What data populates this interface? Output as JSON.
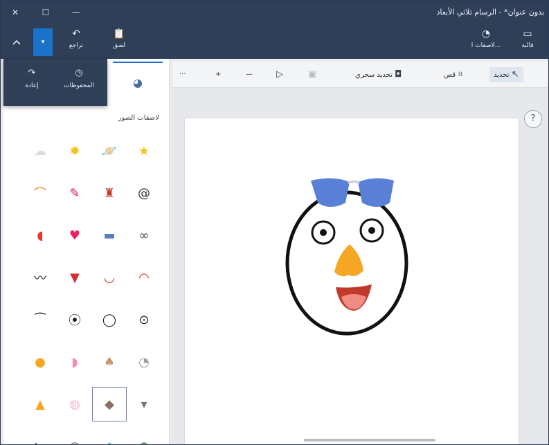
{
  "window": {
    "title": "بدون عنوان* - الرسام ثلاثي الأبعاد",
    "close_glyph": "✕",
    "restore_glyph": "☐",
    "minimize_glyph": "—"
  },
  "ribbon": {
    "canvas_label": "قالبة",
    "stickers_label": "لاصقات ا...",
    "paste_label": "لصق",
    "undo_label": "تراجع",
    "collapse_icon": "chevron-up-icon",
    "dropdown_glyph": "▾"
  },
  "history_menu": {
    "history_label": "المحفوظات",
    "redo_label": "إعادة"
  },
  "toolbar": {
    "select_label": "تحديد",
    "crop_label": "قص",
    "magic_select_label": "تحديد سحري",
    "more_glyph": "···",
    "zoom_in_glyph": "+",
    "zoom_out_glyph": "—"
  },
  "panel": {
    "section_title": "لاصقات الصور",
    "tab_icon": "sticker-icon",
    "stickers": [
      {
        "name": "star-sticker",
        "glyph": "★",
        "color": "#f5c518"
      },
      {
        "name": "planet-sticker",
        "glyph": "🪐",
        "color": "#4caf50"
      },
      {
        "name": "sun-sticker",
        "glyph": "✹",
        "color": "#f7c21a"
      },
      {
        "name": "cloud-sticker",
        "glyph": "☁",
        "color": "#d8dde3"
      },
      {
        "name": "spiral-sticker",
        "glyph": "@",
        "color": "#333333"
      },
      {
        "name": "robot-sticker",
        "glyph": "♜",
        "color": "#c0392b"
      },
      {
        "name": "lollipop-sticker",
        "glyph": "✎",
        "color": "#d81b60"
      },
      {
        "name": "rainbow-sticker",
        "glyph": "⌒",
        "color": "#e67e22"
      },
      {
        "name": "eyes-sticker",
        "glyph": "∞",
        "color": "#444444"
      },
      {
        "name": "glasses-sticker",
        "glyph": "▬",
        "color": "#5b7fb8"
      },
      {
        "name": "heart-sticker",
        "glyph": "♥",
        "color": "#e91e63"
      },
      {
        "name": "lips-sticker",
        "glyph": "◖",
        "color": "#e53935"
      },
      {
        "name": "mouth-sticker",
        "glyph": "◠",
        "color": "#c62828"
      },
      {
        "name": "smile-sticker",
        "glyph": "◡",
        "color": "#c62828"
      },
      {
        "name": "tongue-sticker",
        "glyph": "▼",
        "color": "#d32f2f"
      },
      {
        "name": "mustache-sticker",
        "glyph": "〰",
        "color": "#222222"
      },
      {
        "name": "eye-dot-sticker",
        "glyph": "⊙",
        "color": "#222222"
      },
      {
        "name": "eye-ring-sticker",
        "glyph": "◯",
        "color": "#222222"
      },
      {
        "name": "eye-look-sticker",
        "glyph": "⦿",
        "color": "#222222"
      },
      {
        "name": "eyebrow-sticker",
        "glyph": "⁀",
        "color": "#222222"
      },
      {
        "name": "ear-gray-sticker",
        "glyph": "◔",
        "color": "#9e9e9e"
      },
      {
        "name": "ear-brown-sticker",
        "glyph": "♠",
        "color": "#c8956b"
      },
      {
        "name": "ear-pink-sticker",
        "glyph": "◗",
        "color": "#f48fb1"
      },
      {
        "name": "ear-orange-sticker",
        "glyph": "●",
        "color": "#f5a623"
      },
      {
        "name": "nose-gray-sticker",
        "glyph": "▾",
        "color": "#777777"
      },
      {
        "name": "nose-dog-sticker",
        "glyph": "◆",
        "color": "#8d6e63"
      },
      {
        "name": "nose-pig-sticker",
        "glyph": "◍",
        "color": "#f8b3c8"
      },
      {
        "name": "nose-orange-sticker",
        "glyph": "▲",
        "color": "#f5a623"
      },
      {
        "name": "eye-green-sticker",
        "glyph": "⊕",
        "color": "#2e7d32"
      },
      {
        "name": "eye-blue-sticker",
        "glyph": "◈",
        "color": "#0288d1"
      },
      {
        "name": "eye-brown-sticker",
        "glyph": "◉",
        "color": "#6d4c41"
      },
      {
        "name": "eye-side-sticker",
        "glyph": "◣",
        "color": "#222222"
      }
    ],
    "selected_sticker": "nose-dog-sticker"
  },
  "canvas": {
    "help_glyph": "?"
  },
  "colors": {
    "title_bar": "#2f3f58",
    "accent": "#1a73c8",
    "sunglasses": "#5a7fd6",
    "nose": "#f5a623",
    "mouth": "#c0392b"
  }
}
